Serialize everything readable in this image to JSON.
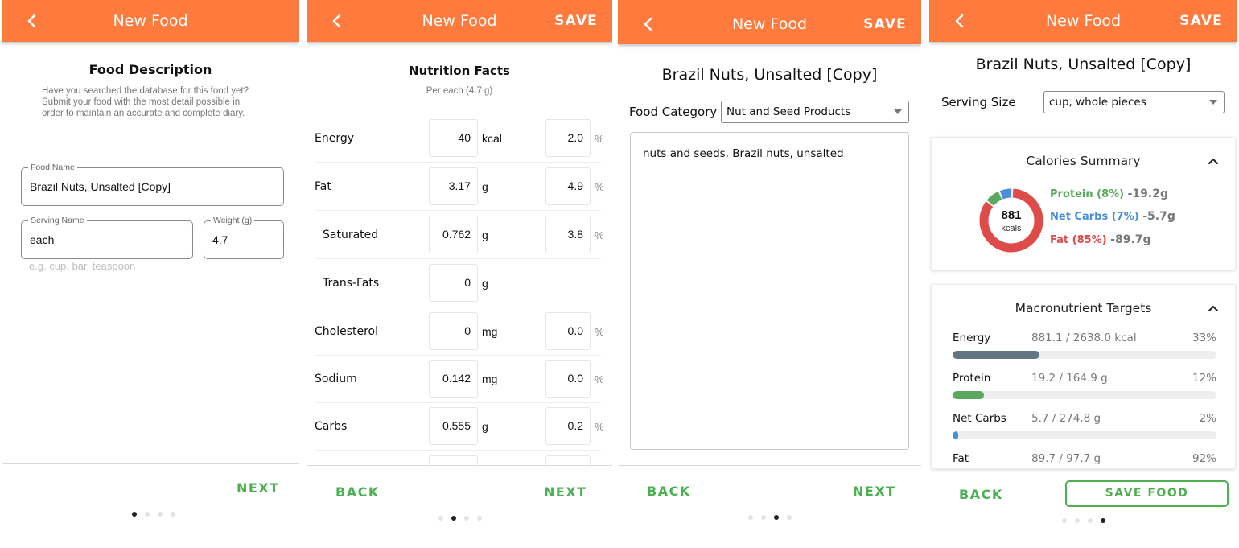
{
  "colors": {
    "accent": "#ff7a3d",
    "green": "#4caf50",
    "protein": "#5aa85d",
    "carbs": "#4a90d9",
    "fat": "#de4c4a",
    "energy": "#617682"
  },
  "panel1": {
    "appbar_title": "New Food",
    "heading": "Food Description",
    "description": "Have you searched the database for this food yet?  Submit your food with the most detail possible in order to maintain an accurate and complete diary.",
    "food_name": {
      "label": "Food Name",
      "value": "Brazil Nuts, Unsalted [Copy]"
    },
    "serving_name": {
      "label": "Serving Name",
      "value": "each",
      "hint": "e.g. cup, bar, teaspoon"
    },
    "weight": {
      "label": "Weight (g)",
      "value": "4.7"
    },
    "next": "NEXT"
  },
  "panel2": {
    "appbar_title": "New Food",
    "save": "SAVE",
    "heading": "Nutrition Facts",
    "subheading": "Per each (4.7 g)",
    "rows": [
      {
        "name": "Energy",
        "value": "40",
        "unit": "kcal",
        "percent": "2.0",
        "pct_sign": "%"
      },
      {
        "name": "Fat",
        "value": "3.17",
        "unit": "g",
        "percent": "4.9",
        "pct_sign": "%"
      },
      {
        "name": "Saturated",
        "value": "0.762",
        "unit": "g",
        "percent": "3.8",
        "pct_sign": "%"
      },
      {
        "name": "Trans-Fats",
        "value": "0",
        "unit": "g",
        "percent": "",
        "pct_sign": ""
      },
      {
        "name": "Cholesterol",
        "value": "0",
        "unit": "mg",
        "percent": "0.0",
        "pct_sign": "%"
      },
      {
        "name": "Sodium",
        "value": "0.142",
        "unit": "mg",
        "percent": "0.0",
        "pct_sign": "%"
      },
      {
        "name": "Carbs",
        "value": "0.555",
        "unit": "g",
        "percent": "0.2",
        "pct_sign": "%"
      }
    ],
    "back": "BACK",
    "next": "NEXT"
  },
  "panel3": {
    "appbar_title": "New Food",
    "save": "SAVE",
    "food_title": "Brazil Nuts, Unsalted [Copy]",
    "category_label": "Food Category",
    "category_value": "Nut and Seed Products",
    "notes": "nuts and seeds, Brazil nuts, unsalted",
    "back": "BACK",
    "next": "NEXT"
  },
  "panel4": {
    "appbar_title": "New Food",
    "save": "SAVE",
    "food_title": "Brazil Nuts, Unsalted [Copy]",
    "serving_label": "Serving Size",
    "serving_value": "cup, whole pieces",
    "calories_summary": {
      "title": "Calories Summary",
      "total": "881",
      "unit": "kcals",
      "protein": {
        "label": "Protein (8%)",
        "grams": "-19.2g",
        "fraction": 0.08
      },
      "carbs": {
        "label": "Net Carbs (7%)",
        "grams": "-5.7g",
        "fraction": 0.07
      },
      "fat": {
        "label": "Fat (85%)",
        "grams": "-89.7g",
        "fraction": 0.85
      }
    },
    "macro_targets": {
      "title": "Macronutrient Targets",
      "rows": [
        {
          "name": "Energy",
          "value": "881.1 / 2638.0 kcal",
          "percent": "33%",
          "fraction": 0.33
        },
        {
          "name": "Protein",
          "value": "19.2 / 164.9 g",
          "percent": "12%",
          "fraction": 0.12
        },
        {
          "name": "Net Carbs",
          "value": "5.7 / 274.8 g",
          "percent": "2%",
          "fraction": 0.02
        },
        {
          "name": "Fat",
          "value": "89.7 / 97.7 g",
          "percent": "92%",
          "fraction": 0.92
        }
      ]
    },
    "back": "BACK",
    "save_food": "SAVE FOOD"
  }
}
